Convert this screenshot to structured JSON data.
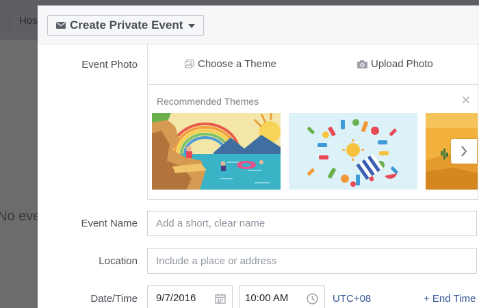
{
  "background": {
    "tab_label": "Hos",
    "empty_text": "No eve"
  },
  "header": {
    "privacy_label": "Create Private Event",
    "privacy_icon": "envelope-icon"
  },
  "event_photo": {
    "label": "Event Photo",
    "choose_theme": "Choose a Theme",
    "upload_photo": "Upload Photo",
    "recommended_title": "Recommended Themes",
    "close_symbol": "✕"
  },
  "event_name": {
    "label": "Event Name",
    "placeholder": "Add a short, clear name"
  },
  "location": {
    "label": "Location",
    "placeholder": "Include a place or address"
  },
  "datetime": {
    "label": "Date/Time",
    "date": "9/7/2016",
    "time": "10:00 AM",
    "timezone": "UTC+08",
    "end_time": "+ End Time"
  },
  "colors": {
    "link": "#365899",
    "text": "#4b4f56",
    "placeholder": "#8d949e"
  }
}
